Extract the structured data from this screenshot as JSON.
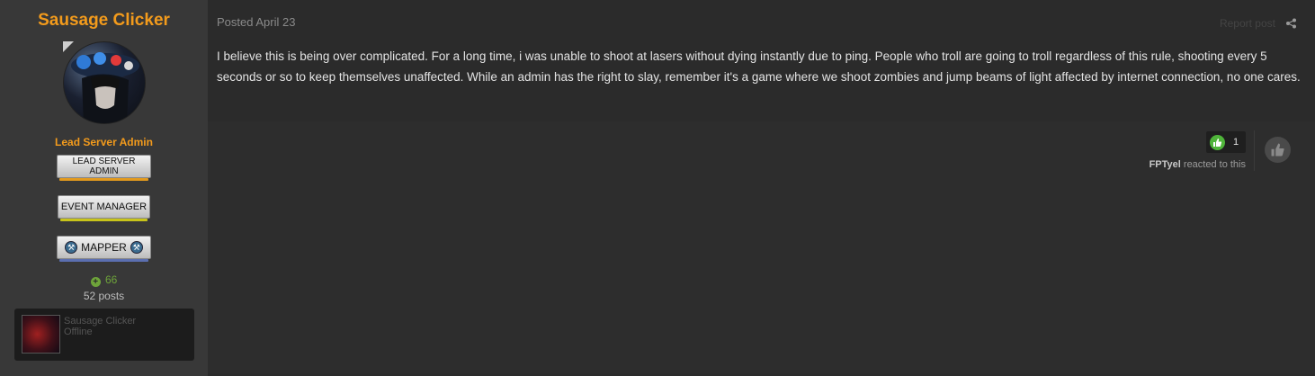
{
  "author": {
    "name": "Sausage Clicker",
    "group_title": "Lead Server Admin",
    "badges": [
      "LEAD SERVER ADMIN",
      "EVENT MANAGER",
      "MAPPER"
    ],
    "reputation": "66",
    "posts": "52 posts",
    "card": {
      "name": "Sausage Clicker",
      "status": "Offline"
    }
  },
  "post": {
    "date": "Posted April 23",
    "report_label": "Report post",
    "body": "I believe this is being over complicated. For a long time, i was unable to shoot at lasers without dying instantly due to ping. People who troll are going to troll regardless of this rule, shooting every 5 seconds or so to keep themselves unaffected. While an admin has the right to slay, remember it's a game where we shoot zombies and jump beams of light affected by internet connection, no one cares."
  },
  "reactions": {
    "count": "1",
    "reactor": "FPTyel",
    "suffix": " reacted to this"
  },
  "icons": [
    "share-icon",
    "thumbs-up-icon",
    "plus-icon",
    "mapper-icon"
  ],
  "colors": {
    "author_name": "#f39b1c",
    "reputation": "#6ea43a",
    "reaction_like": "#4fb43a",
    "page_bg": "#2b2b2b",
    "sidebar_bg": "#383838"
  }
}
